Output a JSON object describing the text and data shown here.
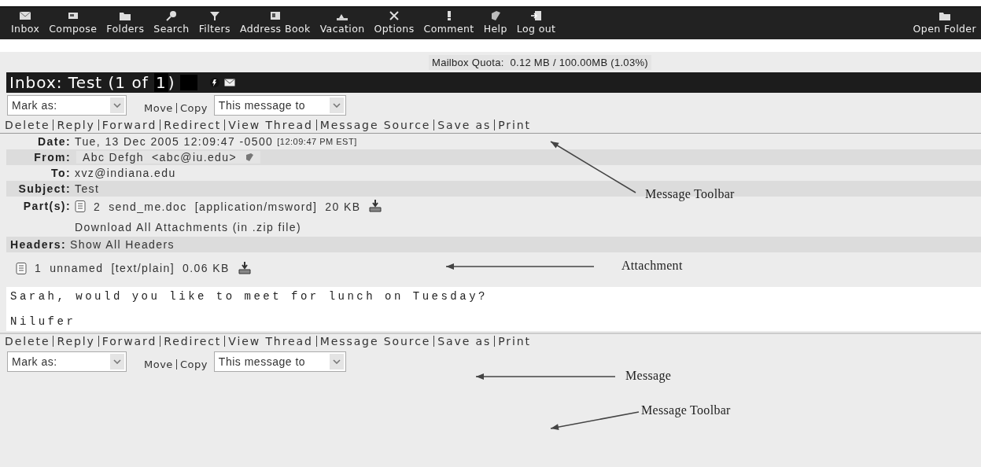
{
  "nav": {
    "items": [
      {
        "label": "Inbox"
      },
      {
        "label": "Compose"
      },
      {
        "label": "Folders"
      },
      {
        "label": "Search"
      },
      {
        "label": "Filters"
      },
      {
        "label": "Address Book"
      },
      {
        "label": "Vacation"
      },
      {
        "label": "Options"
      },
      {
        "label": "Comment"
      },
      {
        "label": "Help"
      },
      {
        "label": "Log out"
      }
    ],
    "open_folder": "Open Folder"
  },
  "quota": "Mailbox Quota:  0.12 MB / 100.00MB (1.03%)",
  "title": {
    "text": "Inbox: Test (1 of ",
    "current": "1",
    "close": ")"
  },
  "actions_top": {
    "mark_as": "Mark as:",
    "move": "Move",
    "copy": "Copy",
    "target": "This message to"
  },
  "toolbar_top": [
    "Delete",
    "Reply",
    "Forward",
    "Redirect",
    "View Thread",
    "Message Source",
    "Save as",
    "Print"
  ],
  "headers": {
    "date_label": "Date:",
    "date": "Tue, 13 Dec 2005 12:09:47 -0500",
    "date_local": "[12:09:47 PM EST]",
    "from_label": "From:",
    "from_name": "Abc Defgh",
    "from_email": "<abc@iu.edu>",
    "to_label": "To:",
    "to": "xvz@indiana.edu",
    "subject_label": "Subject:",
    "subject": "Test",
    "parts_label": "Part(s):"
  },
  "attachments": [
    {
      "number": "2",
      "name": "send_me.doc",
      "type": "[application/msword]",
      "size": "20 KB"
    }
  ],
  "download_all": "Download All Attachments (in .zip file)",
  "headers_row": {
    "label": "Headers:",
    "link": "Show All Headers"
  },
  "body_part": {
    "number": "1",
    "name": "unnamed",
    "type": "[text/plain]",
    "size": "0.06 KB"
  },
  "message": [
    "Sarah, would you like to meet for lunch on Tuesday?",
    "Nilufer"
  ],
  "toolbar_bottom": [
    "Delete",
    "Reply",
    "Forward",
    "Redirect",
    "View Thread",
    "Message Source",
    "Save as",
    "Print"
  ],
  "actions_bottom": {
    "mark_as": "Mark as:",
    "move": "Move",
    "copy": "Copy",
    "target": "This message to"
  },
  "annotations": [
    {
      "text": "Message Toolbar"
    },
    {
      "text": "Attachment"
    },
    {
      "text": "Message"
    },
    {
      "text": "Message Toolbar"
    }
  ]
}
